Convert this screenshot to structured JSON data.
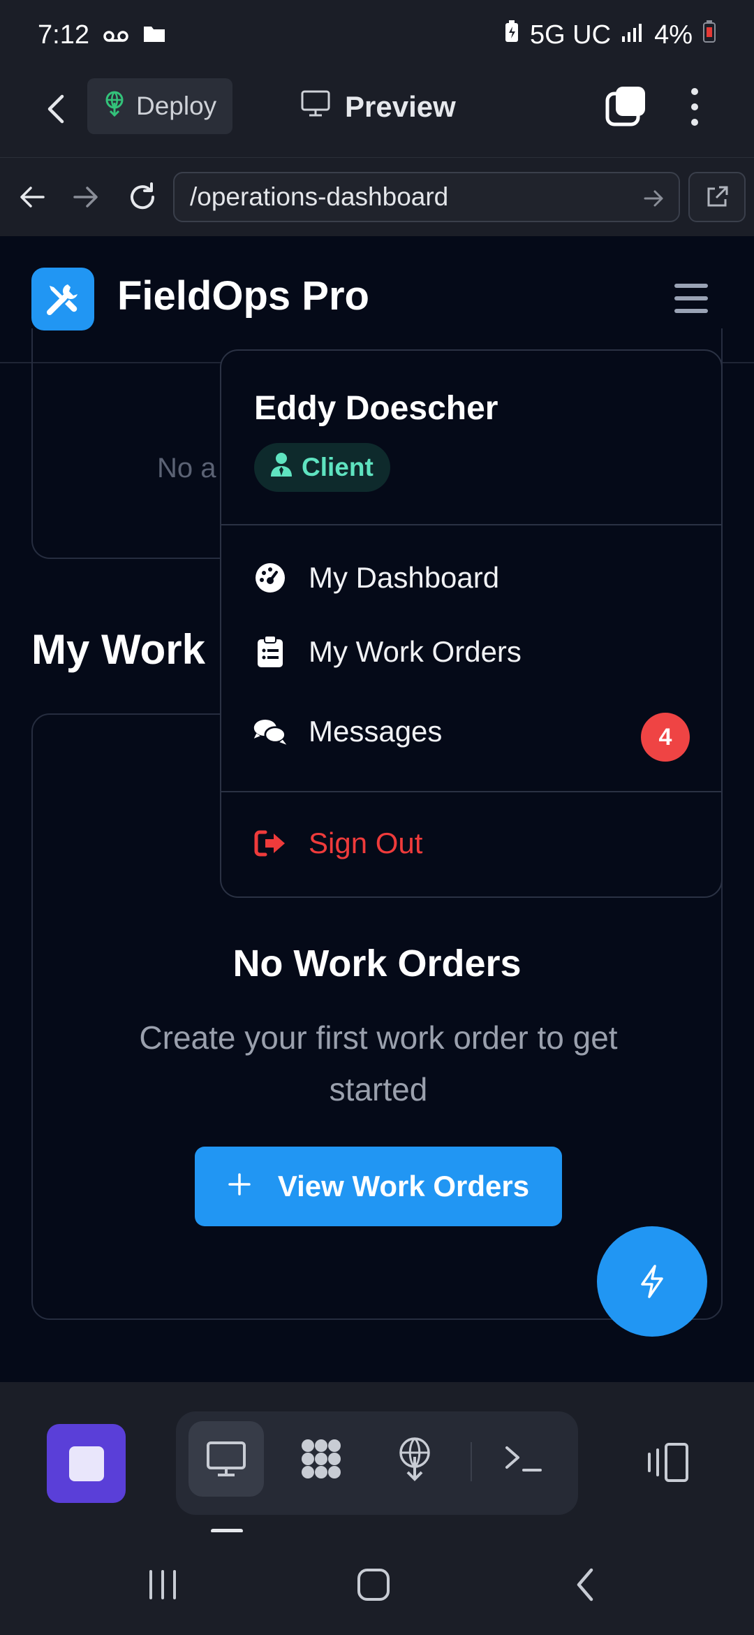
{
  "status_bar": {
    "time": "7:12",
    "network": "5G UC",
    "battery": "4%"
  },
  "toolbar": {
    "deploy_label": "Deploy",
    "preview_label": "Preview"
  },
  "browser": {
    "url": "/operations-dashboard"
  },
  "site": {
    "brand": "FieldOps Pro"
  },
  "page": {
    "top_card_empty_text": "No a",
    "section_title": "My Work",
    "empty_title": "No Work Orders",
    "empty_subtitle": "Create your first work order to get started",
    "view_button_label": "View Work Orders"
  },
  "user_menu": {
    "name": "Eddy Doescher",
    "role": "Client",
    "items": [
      {
        "label": "My Dashboard",
        "icon": "dashboard-gauge-icon"
      },
      {
        "label": "My Work Orders",
        "icon": "clipboard-list-icon"
      },
      {
        "label": "Messages",
        "icon": "comments-icon",
        "badge": "4"
      }
    ],
    "signout_label": "Sign Out"
  },
  "colors": {
    "accent": "#2196f3",
    "danger": "#ef4444",
    "role_text": "#5fe3c0",
    "stop_button": "#5a3fd8"
  }
}
